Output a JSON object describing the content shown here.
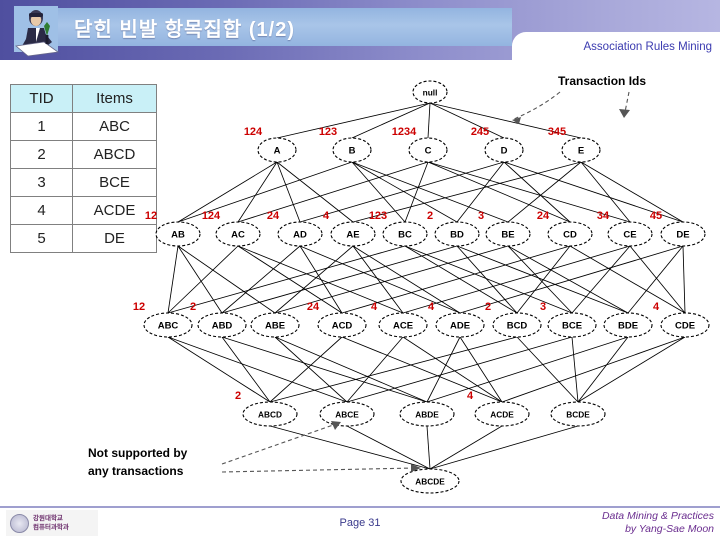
{
  "header": {
    "title": "닫힌 빈발 항목집합 (1/2)",
    "chapter": "Association Rules Mining",
    "presenter_icon": "presenter-icon"
  },
  "transaction_table": {
    "columns": [
      "TID",
      "Items"
    ],
    "rows": [
      {
        "tid": "1",
        "items": "ABC"
      },
      {
        "tid": "2",
        "items": "ABCD"
      },
      {
        "tid": "3",
        "items": "BCE"
      },
      {
        "tid": "4",
        "items": "ACDE"
      },
      {
        "tid": "5",
        "items": "DE"
      }
    ]
  },
  "annotations": {
    "transaction_ids": "Transaction Ids",
    "not_supported": "Not supported by\nany transactions",
    "not_supported_line1": "Not supported by",
    "not_supported_line2": "any transactions"
  },
  "lattice": {
    "root": {
      "label": "null",
      "tids": ""
    },
    "level1": [
      {
        "label": "A",
        "tids": "124"
      },
      {
        "label": "B",
        "tids": "123"
      },
      {
        "label": "C",
        "tids": "1234"
      },
      {
        "label": "D",
        "tids": "245"
      },
      {
        "label": "E",
        "tids": "345"
      }
    ],
    "level2": [
      {
        "label": "AB",
        "tids": "12"
      },
      {
        "label": "AC",
        "tids": "124"
      },
      {
        "label": "AD",
        "tids": "24"
      },
      {
        "label": "AE",
        "tids": "4"
      },
      {
        "label": "BC",
        "tids": "123"
      },
      {
        "label": "BD",
        "tids": "2"
      },
      {
        "label": "BE",
        "tids": "3"
      },
      {
        "label": "CD",
        "tids": "24"
      },
      {
        "label": "CE",
        "tids": "34"
      },
      {
        "label": "DE",
        "tids": "45"
      }
    ],
    "level3": [
      {
        "label": "ABC",
        "tids": "12"
      },
      {
        "label": "ABD",
        "tids": "2"
      },
      {
        "label": "ABE",
        "tids": ""
      },
      {
        "label": "ACD",
        "tids": "24"
      },
      {
        "label": "ACE",
        "tids": "4"
      },
      {
        "label": "ADE",
        "tids": "4"
      },
      {
        "label": "BCD",
        "tids": "2"
      },
      {
        "label": "BCE",
        "tids": "3"
      },
      {
        "label": "BDE",
        "tids": ""
      },
      {
        "label": "CDE",
        "tids": "4"
      }
    ],
    "level4": [
      {
        "label": "ABCD",
        "tids": "2"
      },
      {
        "label": "ABCE",
        "tids": ""
      },
      {
        "label": "ABDE",
        "tids": ""
      },
      {
        "label": "ACDE",
        "tids": "4"
      },
      {
        "label": "BCDE",
        "tids": ""
      }
    ],
    "level5": [
      {
        "label": "ABCDE",
        "tids": ""
      }
    ]
  },
  "footer": {
    "page": "Page 31",
    "credit_line1": "Data Mining & Practices",
    "credit_line2": "by Yang-Sae Moon",
    "university": "강원대학교\n컴퓨터과학과"
  },
  "colors": {
    "tid_red": "#cc0000",
    "header_blue": "#93b4e0",
    "chapter_blue": "#3b3bb0",
    "table_head": "#c9f0f7",
    "credit_purple": "#6a2d8f"
  }
}
